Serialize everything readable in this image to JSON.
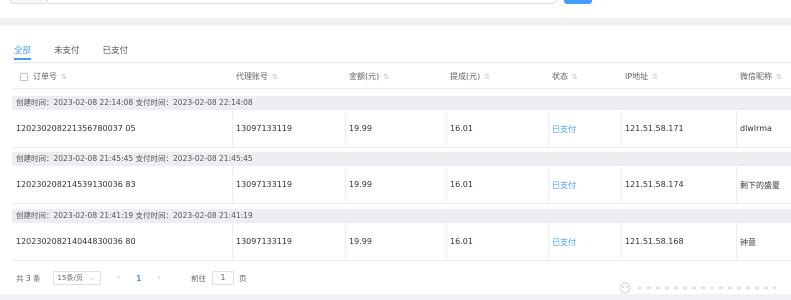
{
  "colors": {
    "accent": "#409eff",
    "group_bg": "#eceef2",
    "border": "#ebeef5"
  },
  "tabs": [
    {
      "label": "全部",
      "active": true
    },
    {
      "label": "未支付",
      "active": false
    },
    {
      "label": "已支付",
      "active": false
    }
  ],
  "table": {
    "columns": [
      "订单号",
      "代理账号",
      "金额(元)",
      "提成(元)",
      "状态",
      "IP地址",
      "微信昵称"
    ],
    "groups": [
      {
        "header": "创建时间：2023-02-08 22:14:08   支付时间：2023-02-08 22:14:08",
        "order": "120230208221356780037 05",
        "agent": "13097133119",
        "amount": "19.99",
        "commission": "16.01",
        "status": "已支付",
        "ip": "121.51.58.171",
        "nickname": "dlwlrma"
      },
      {
        "header": "创建时间：2023-02-08 21:45:45   支付时间：2023-02-08 21:45:45",
        "order": "120230208214539130036 83",
        "agent": "13097133119",
        "amount": "19.99",
        "commission": "16.01",
        "status": "已支付",
        "ip": "121.51.58.174",
        "nickname": "剩下的盛夏"
      },
      {
        "header": "创建时间：2023-02-08 21:41:19   支付时间：2023-02-08 21:41:19",
        "order": "120230208214044830036 80",
        "agent": "13097133119",
        "amount": "19.99",
        "commission": "16.01",
        "status": "已支付",
        "ip": "121.51.58.168",
        "nickname": "钟意"
      }
    ]
  },
  "pagination": {
    "total": "共 3 条",
    "page_size": "15条/页",
    "current_page": "1",
    "goto_label": "前往",
    "goto_value": "1",
    "page_unit": "页"
  }
}
